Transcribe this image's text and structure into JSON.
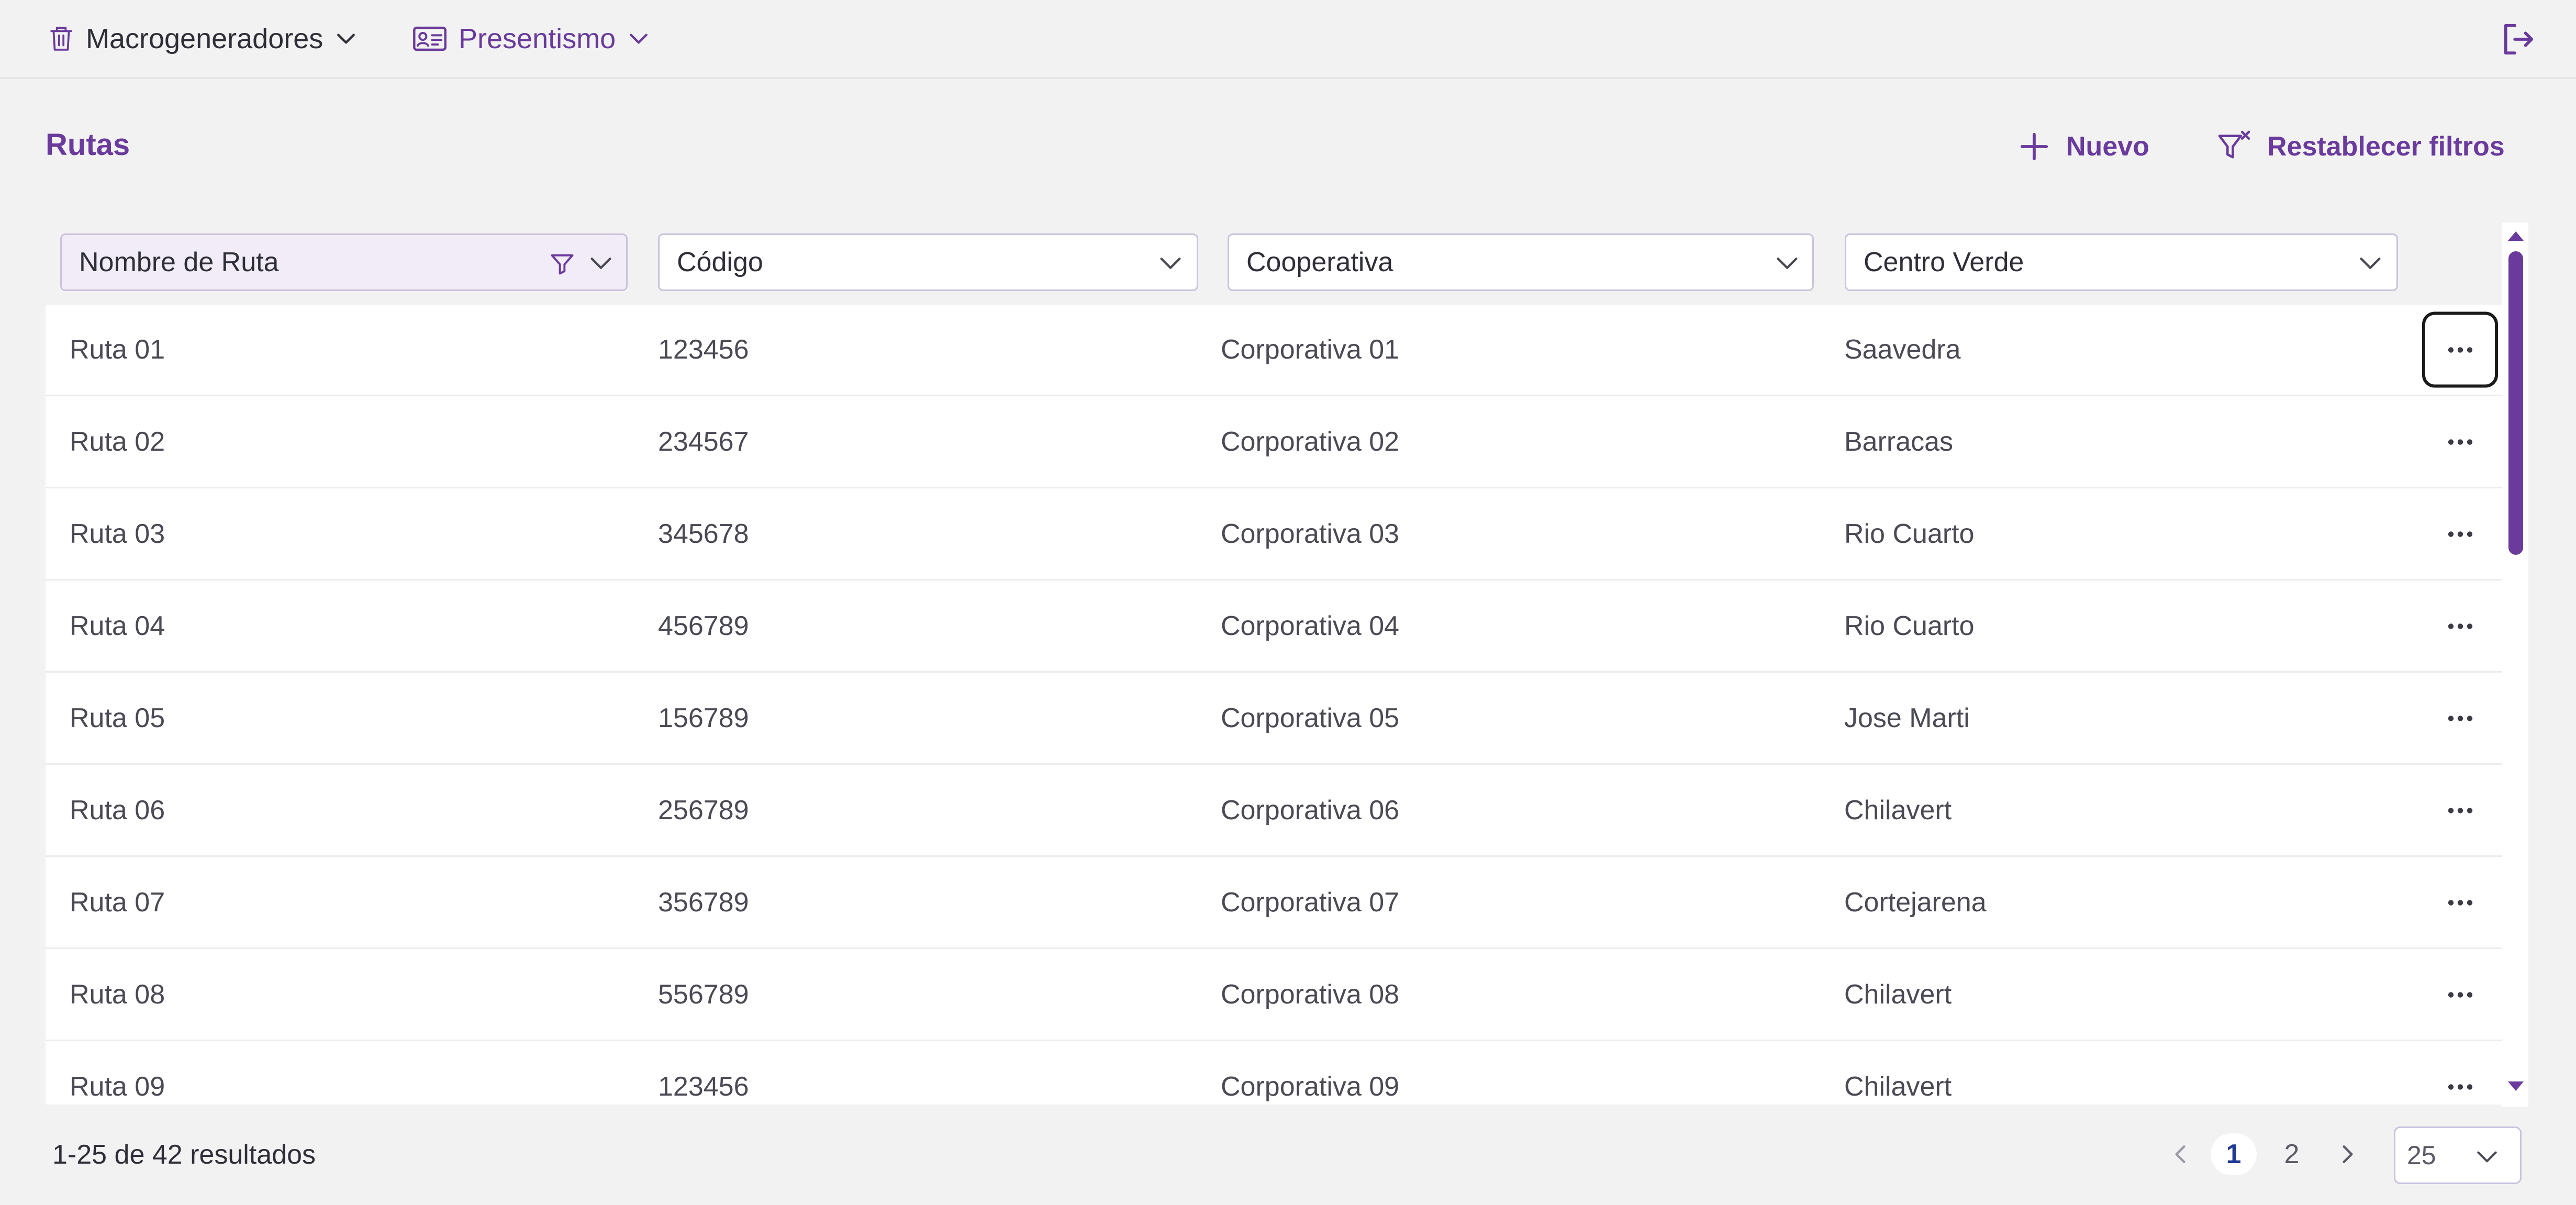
{
  "topnav": {
    "module": "Macrogeneradores",
    "section": "Presentismo"
  },
  "page": {
    "title": "Rutas",
    "new_label": "Nuevo",
    "reset_filters_label": "Restablecer filtros"
  },
  "filters": {
    "nombre": "Nombre de Ruta",
    "codigo": "Código",
    "cooperativa": "Cooperativa",
    "centro": "Centro Verde"
  },
  "rows": [
    {
      "nombre": "Ruta 01",
      "codigo": "123456",
      "cooperativa": "Corporativa 01",
      "centro": "Saavedra"
    },
    {
      "nombre": "Ruta 02",
      "codigo": "234567",
      "cooperativa": "Corporativa 02",
      "centro": "Barracas"
    },
    {
      "nombre": "Ruta 03",
      "codigo": "345678",
      "cooperativa": "Corporativa 03",
      "centro": "Rio Cuarto"
    },
    {
      "nombre": "Ruta 04",
      "codigo": "456789",
      "cooperativa": "Corporativa 04",
      "centro": "Rio Cuarto"
    },
    {
      "nombre": "Ruta 05",
      "codigo": "156789",
      "cooperativa": "Corporativa 05",
      "centro": "Jose Marti"
    },
    {
      "nombre": "Ruta 06",
      "codigo": "256789",
      "cooperativa": "Corporativa 06",
      "centro": "Chilavert"
    },
    {
      "nombre": "Ruta 07",
      "codigo": "356789",
      "cooperativa": "Corporativa 07",
      "centro": "Cortejarena"
    },
    {
      "nombre": "Ruta 08",
      "codigo": "556789",
      "cooperativa": "Corporativa 08",
      "centro": "Chilavert"
    },
    {
      "nombre": "Ruta 09",
      "codigo": "123456",
      "cooperativa": "Corporativa 09",
      "centro": "Chilavert"
    }
  ],
  "footer": {
    "summary": "1-25 de 42 resultados",
    "pages": [
      "1",
      "2"
    ],
    "current_page": "1",
    "page_size": "25"
  },
  "colors": {
    "accent": "#6a3a9c",
    "background": "#f2f2f2",
    "text": "#3b3b46"
  },
  "icons": {
    "module": "trash-icon",
    "section": "id-card-icon",
    "logout": "logout-icon",
    "new": "plus-icon",
    "reset": "filter-clear-icon",
    "filter_active": "filter-icon",
    "dropdown": "chevron-down-icon",
    "row_actions": "more-horizontal-icon"
  }
}
